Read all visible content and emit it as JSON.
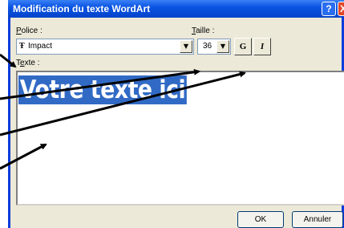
{
  "dialog": {
    "title": "Modification du texte WordArt",
    "help_glyph": "?",
    "close_glyph": "X"
  },
  "font": {
    "label_accel": "P",
    "label_rest": "olice :",
    "value": "Impact",
    "icon": "truetype-font-icon",
    "icon_glyph": "Ŧ"
  },
  "size": {
    "label_accel": "T",
    "label_rest": "aille :",
    "value": "36"
  },
  "format": {
    "bold_label": "G",
    "italic_label": "I"
  },
  "text": {
    "label_pre": "T",
    "label_accel": "e",
    "label_rest": "xte :",
    "content": "Votre texte ici",
    "selection_color": "#316ac5"
  },
  "buttons": {
    "ok": "OK",
    "cancel": "Annuler"
  },
  "colors": {
    "titlebar": "#0a54e3",
    "dialog_bg": "#ece9d8",
    "close_red": "#e2462a"
  }
}
